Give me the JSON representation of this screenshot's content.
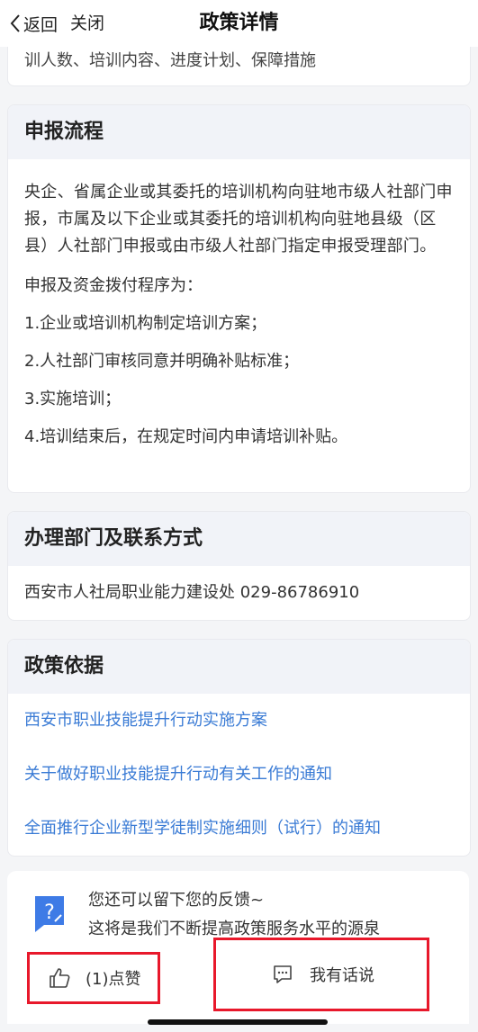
{
  "nav": {
    "back_label": "返回",
    "close_label": "关闭",
    "title": "政策详情"
  },
  "prev_section": {
    "partial_text": "训人数、培训内容、进度计划、保障措施"
  },
  "process": {
    "heading": "申报流程",
    "paragraph": "央企、省属企业或其委托的培训机构向驻地市级人社部门申报，市属及以下企业或其委托的培训机构向驻地县级（区县）人社部门申报或由市级人社部门指定申报受理部门。",
    "lines": [
      "申报及资金拨付程序为：",
      "1.企业或培训机构制定培训方案；",
      "2.人社部门审核同意并明确补贴标准；",
      "3.实施培训；",
      "4.培训结束后，在规定时间内申请培训补贴。"
    ]
  },
  "department": {
    "heading": "办理部门及联系方式",
    "contact": "西安市人社局职业能力建设处 029-86786910"
  },
  "basis": {
    "heading": "政策依据",
    "links": [
      "西安市职业技能提升行动实施方案",
      "关于做好职业技能提升行动有关工作的通知",
      "全面推行企业新型学徒制实施细则（试行）的通知"
    ]
  },
  "feedback": {
    "line1": "您还可以留下您的反馈~",
    "line2": "这将是我们不断提高政策服务水平的源泉",
    "like_label": "(1)点赞",
    "comment_label": "我有话说"
  },
  "colors": {
    "link": "#3a7bd5",
    "highlight_border": "#e8182b",
    "icon_blue": "#3e7be6"
  }
}
